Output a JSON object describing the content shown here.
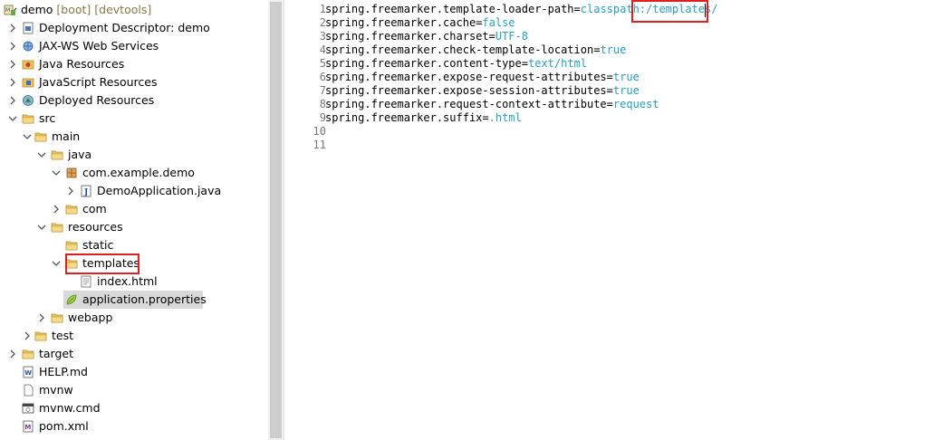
{
  "explorer": {
    "items": [
      {
        "label": "demo",
        "decoration": " [boot] [devtools]",
        "icon": "project-icon",
        "expanded": true
      },
      {
        "label": "Deployment Descriptor: demo",
        "icon": "deployment-descriptor-icon",
        "expanded": false
      },
      {
        "label": "JAX-WS Web Services",
        "icon": "web-services-icon",
        "expanded": false
      },
      {
        "label": "Java Resources",
        "icon": "java-resources-icon",
        "expanded": false
      },
      {
        "label": "JavaScript Resources",
        "icon": "javascript-resources-icon",
        "expanded": false
      },
      {
        "label": "Deployed Resources",
        "icon": "deployed-resources-icon",
        "expanded": false
      },
      {
        "label": "src",
        "icon": "folder-icon",
        "expanded": true
      },
      {
        "label": "main",
        "icon": "folder-icon",
        "expanded": true
      },
      {
        "label": "java",
        "icon": "folder-icon",
        "expanded": true
      },
      {
        "label": "com.example.demo",
        "icon": "package-icon",
        "expanded": true
      },
      {
        "label": "DemoApplication.java",
        "icon": "java-file-icon",
        "expanded": false
      },
      {
        "label": "com",
        "icon": "folder-icon",
        "expanded": false
      },
      {
        "label": "resources",
        "icon": "folder-icon",
        "expanded": true
      },
      {
        "label": "static",
        "icon": "folder-icon"
      },
      {
        "label": "templates",
        "icon": "folder-icon",
        "expanded": true
      },
      {
        "label": "index.html",
        "icon": "html-file-icon"
      },
      {
        "label": "application.properties",
        "icon": "spring-properties-icon",
        "selected": true
      },
      {
        "label": "webapp",
        "icon": "folder-icon",
        "expanded": false
      },
      {
        "label": "test",
        "icon": "folder-icon",
        "expanded": false
      },
      {
        "label": "target",
        "icon": "folder-icon",
        "expanded": false
      },
      {
        "label": "HELP.md",
        "icon": "markdown-file-icon"
      },
      {
        "label": "mvnw",
        "icon": "file-icon"
      },
      {
        "label": "mvnw.cmd",
        "icon": "cmd-file-icon"
      },
      {
        "label": "pom.xml",
        "icon": "xml-file-icon"
      }
    ]
  },
  "editor": {
    "lines": [
      {
        "n": "1",
        "key": "spring.freemarker.template-loader-path=",
        "value": "classpath:/templates/"
      },
      {
        "n": "2",
        "key": "spring.freemarker.cache=",
        "value": "false"
      },
      {
        "n": "3",
        "key": "spring.freemarker.charset=",
        "value": "UTF-8"
      },
      {
        "n": "4",
        "key": "spring.freemarker.check-template-location=",
        "value": "true"
      },
      {
        "n": "5",
        "key": "spring.freemarker.content-type=",
        "value": "text/html"
      },
      {
        "n": "6",
        "key": "spring.freemarker.expose-request-attributes=",
        "value": "true"
      },
      {
        "n": "7",
        "key": "spring.freemarker.expose-session-attributes=",
        "value": "true"
      },
      {
        "n": "8",
        "key": "spring.freemarker.request-context-attribute=",
        "value": "request"
      },
      {
        "n": "9",
        "key": "spring.freemarker.suffix=",
        "value": ".html"
      },
      {
        "n": "10",
        "key": "",
        "value": ""
      },
      {
        "n": "11",
        "key": "",
        "value": ""
      }
    ]
  },
  "colors": {
    "highlight_box": "#e02020",
    "property_value": "#2a9fbf",
    "selection": "#d9d9d9",
    "folder": "#e8c25c"
  }
}
